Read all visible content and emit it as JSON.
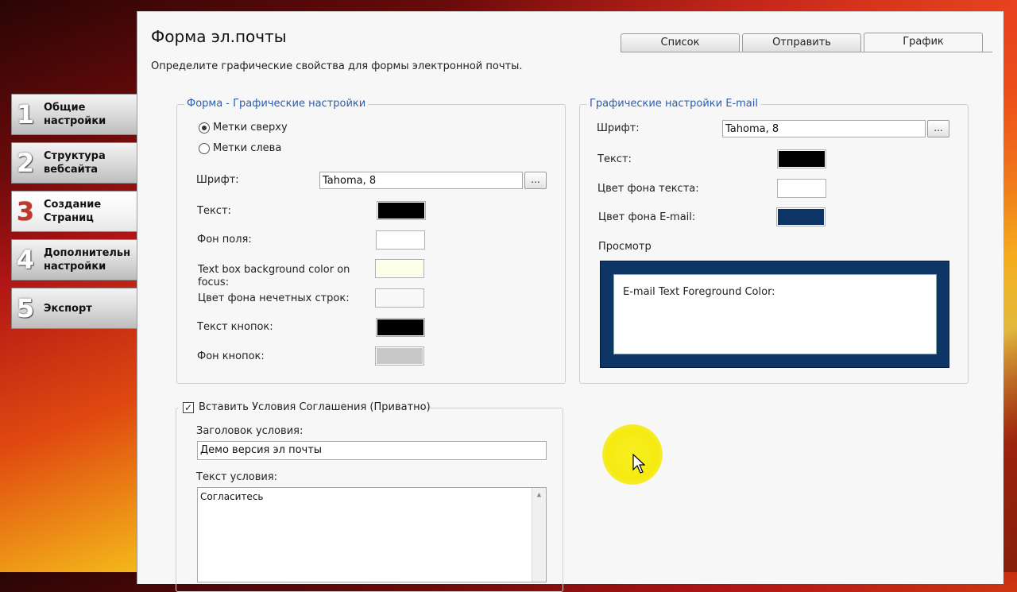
{
  "steps": [
    {
      "num": "1",
      "label": "Общие\nнастройки"
    },
    {
      "num": "2",
      "label": "Структура\nвебсайта"
    },
    {
      "num": "3",
      "label": "Создание\nСтраниц"
    },
    {
      "num": "4",
      "label": "Дополнительн\nнастройки"
    },
    {
      "num": "5",
      "label": "Экспорт"
    }
  ],
  "header": {
    "title": "Форма эл.почты",
    "subtitle": "Определите графические свойства для формы электронной почты."
  },
  "tabs": [
    "Список",
    "Отправить",
    "График"
  ],
  "active_tab": "График",
  "form_group": {
    "legend": "Форма - Графические настройки",
    "radio_top": "Метки сверху",
    "radio_left": "Метки слева",
    "font_label": "Шрифт:",
    "font_value": "Tahoma, 8",
    "dots": "...",
    "text_label": "Текст:",
    "field_bg_label": "Фон поля:",
    "focus_bg_label": "Text box background color on focus:",
    "odd_rows_label": "Цвет фона нечетных строк:",
    "button_text_label": "Текст кнопок:",
    "button_bg_label": "Фон кнопок:",
    "colors": {
      "text": "#000000",
      "field_bg": "#ffffff",
      "focus_bg": "#fbffe8",
      "odd_rows": "#f8f8f8",
      "button_text": "#000000",
      "button_bg": "#c8c8c8"
    }
  },
  "email_group": {
    "legend": "Графические настройки E-mail",
    "font_label": "Шрифт:",
    "font_value": "Tahoma, 8",
    "dots": "...",
    "text_label": "Текст:",
    "text_bg_label": "Цвет фона текста:",
    "email_bg_label": "Цвет фона E-mail:",
    "preview_label": "Просмотр",
    "preview_text": "E-mail Text Foreground Color:",
    "colors": {
      "text": "#000000",
      "text_bg": "#ffffff",
      "email_bg": "#0d3565"
    }
  },
  "terms_group": {
    "checkbox_label": "Вставить Условия Соглашения (Приватно)",
    "checked": true,
    "check_mark": "✓",
    "heading_label": "Заголовок условия:",
    "heading_value": "Демо версия эл почты",
    "text_label": "Текст условия:",
    "text_value": "Согласитесь"
  }
}
